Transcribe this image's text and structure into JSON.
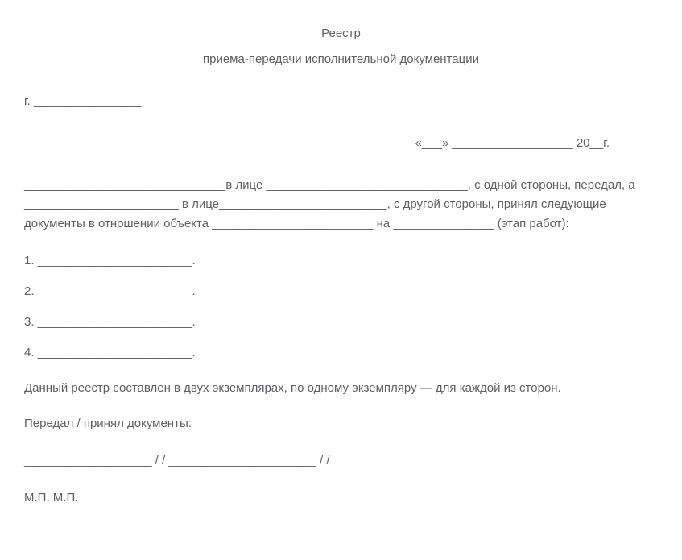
{
  "header": {
    "title": "Реестр",
    "subtitle": "приема-передачи исполнительной документации"
  },
  "city_line": "г. ________________",
  "date_line": "«___» __________________ 20__г.",
  "body": "______________________________в лице ______________________________, с одной стороны, передал, а _______________________ в лице_________________________, с другой стороны, принял следующие документы в отношении объекта ________________________ на _______________ (этап работ):",
  "list": {
    "item1": "1. _______________________.",
    "item2": "2. _______________________.",
    "item3": "3. _______________________.",
    "item4": "4. _______________________."
  },
  "copies_text": "Данный реестр составлен в двух экземплярах, по одному экземпляру — для каждой из сторон.",
  "handover_label": "Передал / принял документы:",
  "sign_line": "___________________ / / ______________________ / /",
  "stamp": "М.П. М.П."
}
